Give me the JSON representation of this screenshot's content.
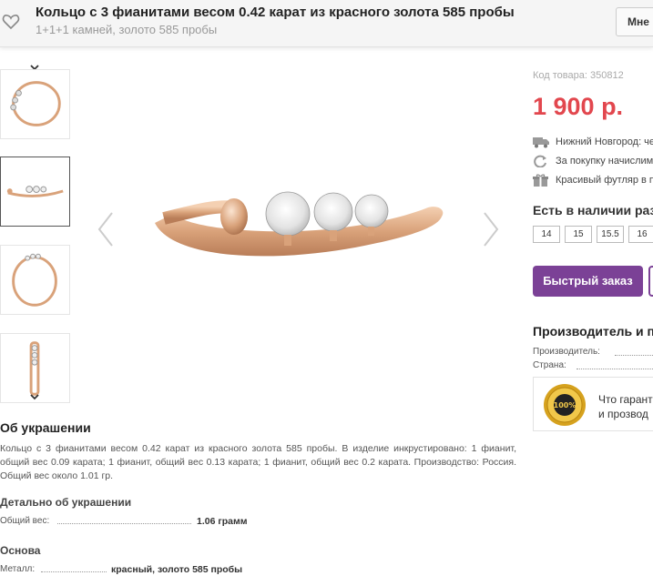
{
  "header": {
    "title": "Кольцо с 3 фианитами весом 0.42 карат из красного золота 585 пробы",
    "subtitle": "1+1+1 камней, золото 585 пробы",
    "button_label": "Мне"
  },
  "product": {
    "sku": "Код товара: 350812",
    "price": "1 900 р.",
    "delivery": "Нижний Новгород: че",
    "bonus": "За покупку начислим",
    "gift": "Красивый футляр в п",
    "stock_title": "Есть в наличии разм",
    "sizes": [
      "14",
      "15",
      "15.5",
      "16"
    ],
    "quick_order_label": "Быстрый заказ"
  },
  "maker": {
    "title": "Производитель и п",
    "manufacturer_label": "Производитель:",
    "country_label": "Страна:"
  },
  "guarantee": {
    "seal_text": "100%",
    "line1": "Что гарант",
    "line2": "и прозвод"
  },
  "about": {
    "title": "Об украшении",
    "text": "Кольцо с 3 фианитами весом 0.42 карат из красного золота 585 пробы. В изделие инкрустировано: 1 фианит, общий вес 0.09 карата; 1 фианит, общий вес 0.13 карата; 1 фианит, общий вес 0.2 карата. Производство: Россия. Общий вес около 1.01 гр."
  },
  "details": {
    "title": "Детально об украшении",
    "weight_label": "Общий вес:",
    "weight_value": "1.06 грамм"
  },
  "base": {
    "title": "Основа",
    "metal_label": "Металл:",
    "metal_value": "красный, золото 585 пробы"
  },
  "colors": {
    "price": "#e2474e",
    "accent": "#7b4196",
    "gold": "#d9a27a"
  }
}
